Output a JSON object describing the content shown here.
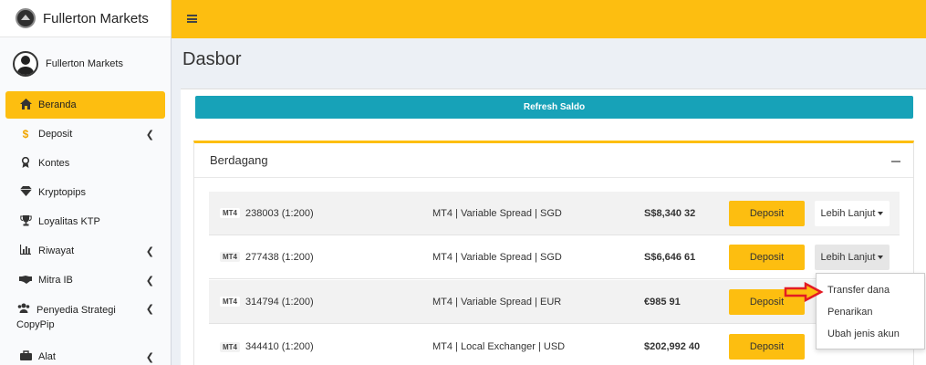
{
  "brand": {
    "title": "Fullerton Markets"
  },
  "user": {
    "name": "Fullerton Markets"
  },
  "sidebar": {
    "items": [
      {
        "label": "Beranda",
        "icon": "home-icon",
        "active": true,
        "chevron": false
      },
      {
        "label": "Deposit",
        "icon": "dollar-icon",
        "chevron": true
      },
      {
        "label": "Kontes",
        "icon": "award-icon",
        "chevron": false
      },
      {
        "label": "Kryptopips",
        "icon": "diamond-icon",
        "chevron": false
      },
      {
        "label": "Loyalitas KTP",
        "icon": "trophy-icon",
        "chevron": false
      },
      {
        "label": "Riwayat",
        "icon": "bar-chart-icon",
        "chevron": true
      },
      {
        "label": "Mitra IB",
        "icon": "handshake-icon",
        "chevron": true
      },
      {
        "label": "Penyedia Strategi CopyPip",
        "icon": "users-icon",
        "chevron": true
      },
      {
        "label": "Alat",
        "icon": "toolbox-icon",
        "chevron": true
      }
    ]
  },
  "page": {
    "title": "Dasbor"
  },
  "refresh": {
    "label": "Refresh Saldo"
  },
  "panel": {
    "title": "Berdagang"
  },
  "accounts": [
    {
      "badge": "MT4",
      "account": "238003 (1:200)",
      "type": "MT4 | Variable Spread | SGD",
      "balance": "S$8,340 32",
      "deposit_label": "Deposit",
      "more_label": "Lebih Lanjut"
    },
    {
      "badge": "MT4",
      "account": "277438 (1:200)",
      "type": "MT4 | Variable Spread | SGD",
      "balance": "S$6,646 61",
      "deposit_label": "Deposit",
      "more_label": "Lebih Lanjut"
    },
    {
      "badge": "MT4",
      "account": "314794 (1:200)",
      "type": "MT4 | Variable Spread | EUR",
      "balance": "€985 91",
      "deposit_label": "Deposit",
      "more_label": ""
    },
    {
      "badge": "MT4",
      "account": "344410 (1:200)",
      "type": "MT4 | Local Exchanger | USD",
      "balance": "$202,992 40",
      "deposit_label": "Deposit",
      "more_label": ""
    }
  ],
  "dropdown": {
    "items": [
      "Transfer dana",
      "Penarikan",
      "Ubah jenis akun"
    ]
  },
  "colors": {
    "accent": "#fdbe10",
    "teal": "#17a2b8",
    "annotation_arrow": "#e31b23"
  }
}
